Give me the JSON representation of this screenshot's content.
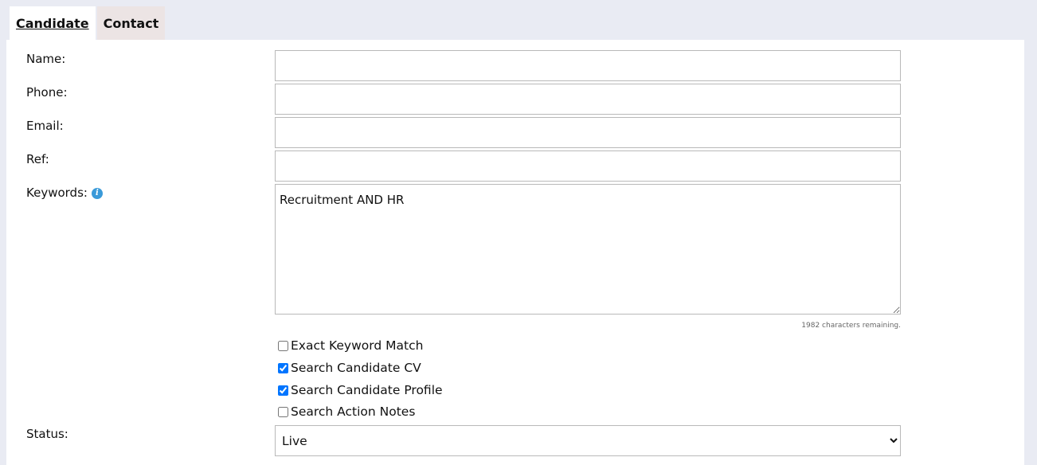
{
  "tabs": [
    {
      "label": "Candidate",
      "active": true
    },
    {
      "label": "Contact",
      "active": false
    }
  ],
  "form": {
    "name": {
      "label": "Name:",
      "value": ""
    },
    "phone": {
      "label": "Phone:",
      "value": ""
    },
    "email": {
      "label": "Email:",
      "value": ""
    },
    "ref": {
      "label": "Ref:",
      "value": ""
    },
    "keywords": {
      "label": "Keywords:",
      "value": "Recruitment AND HR",
      "chars_remaining": "1982 characters remaining."
    },
    "options": [
      {
        "label": "Exact Keyword Match",
        "checked": false
      },
      {
        "label": "Search Candidate CV",
        "checked": true
      },
      {
        "label": "Search Candidate Profile",
        "checked": true
      },
      {
        "label": "Search Action Notes",
        "checked": false
      }
    ],
    "status": {
      "label": "Status:",
      "selected": "Live"
    }
  },
  "icons": {
    "keywords_info": "info-icon"
  },
  "colors": {
    "page_background": "#e9ebf3",
    "inactive_tab": "#ece4e4",
    "info_icon": "#3a9ad9"
  }
}
